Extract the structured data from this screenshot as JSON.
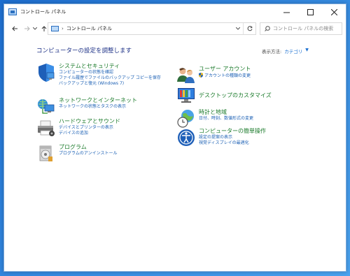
{
  "window": {
    "title": "コントロール パネル",
    "controls": {
      "minimize": "—",
      "maximize": "□",
      "close": "✕"
    }
  },
  "nav": {
    "back_icon": "arrow-left-icon",
    "forward_icon": "arrow-right-icon",
    "recent_icon": "chevron-down-icon",
    "up_icon": "arrow-up-icon"
  },
  "address": {
    "crumb": "コントロール パネル",
    "separator": "›"
  },
  "search": {
    "placeholder": "コントロール パネルの検索"
  },
  "main": {
    "heading": "コンピューターの設定を調整します",
    "view_by_label": "表示方法:",
    "view_by_value": "カテゴリ",
    "view_by_arrow": "▼"
  },
  "categories": [
    {
      "title": "システムとセキュリティ",
      "icon": "shield-icon",
      "links": [
        "コンピューターの状態を確認",
        "ファイル履歴でファイルのバックアップ コピーを保存",
        "バックアップと復元 (Windows 7)"
      ]
    },
    {
      "title": "ネットワークとインターネット",
      "icon": "network-icon",
      "links": [
        "ネットワークの状態とタスクの表示"
      ]
    },
    {
      "title": "ハードウェアとサウンド",
      "icon": "printer-icon",
      "links": [
        "デバイスとプリンターの表示",
        "デバイスの追加"
      ]
    },
    {
      "title": "プログラム",
      "icon": "programs-icon",
      "links": [
        "プログラムのアンインストール"
      ]
    },
    {
      "title": "ユーザー アカウント",
      "icon": "users-icon",
      "links": [
        "アカウントの種類の変更"
      ]
    },
    {
      "title": "デスクトップのカスタマイズ",
      "icon": "monitor-icon",
      "links": []
    },
    {
      "title": "時計と地域",
      "icon": "clock-globe-icon",
      "links": [
        "日付、時刻、数値形式の変更"
      ]
    },
    {
      "title": "コンピューターの簡単操作",
      "icon": "ease-of-access-icon",
      "links": [
        "設定の提案の表示",
        "視覚ディスプレイの最適化"
      ]
    }
  ]
}
